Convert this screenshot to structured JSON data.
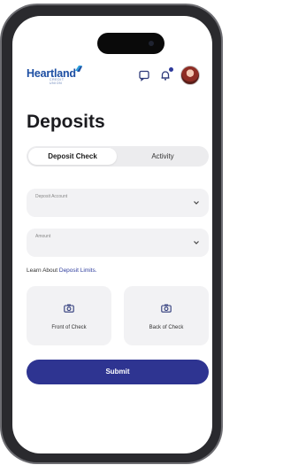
{
  "header": {
    "logo_text": "Heartland",
    "logo_subtext": "CREDIT UNION",
    "icons": [
      "chat-icon",
      "bell-icon",
      "avatar"
    ]
  },
  "page": {
    "title": "Deposits"
  },
  "tabs": [
    {
      "label": "Deposit Check",
      "active": true
    },
    {
      "label": "Activity",
      "active": false
    }
  ],
  "form": {
    "deposit_account": {
      "label": "Deposit Account",
      "value": ""
    },
    "amount": {
      "label": "Amount",
      "value": ""
    }
  },
  "limits": {
    "prefix": "Learn About",
    "link": "Deposit Limits."
  },
  "capture": {
    "front_label": "Front of Check",
    "back_label": "Back of Check"
  },
  "submit_label": "Submit",
  "colors": {
    "brand_blue": "#1e4fa3",
    "primary_button": "#2e3491",
    "link": "#2f3e9e",
    "field_bg": "#f2f2f4"
  }
}
